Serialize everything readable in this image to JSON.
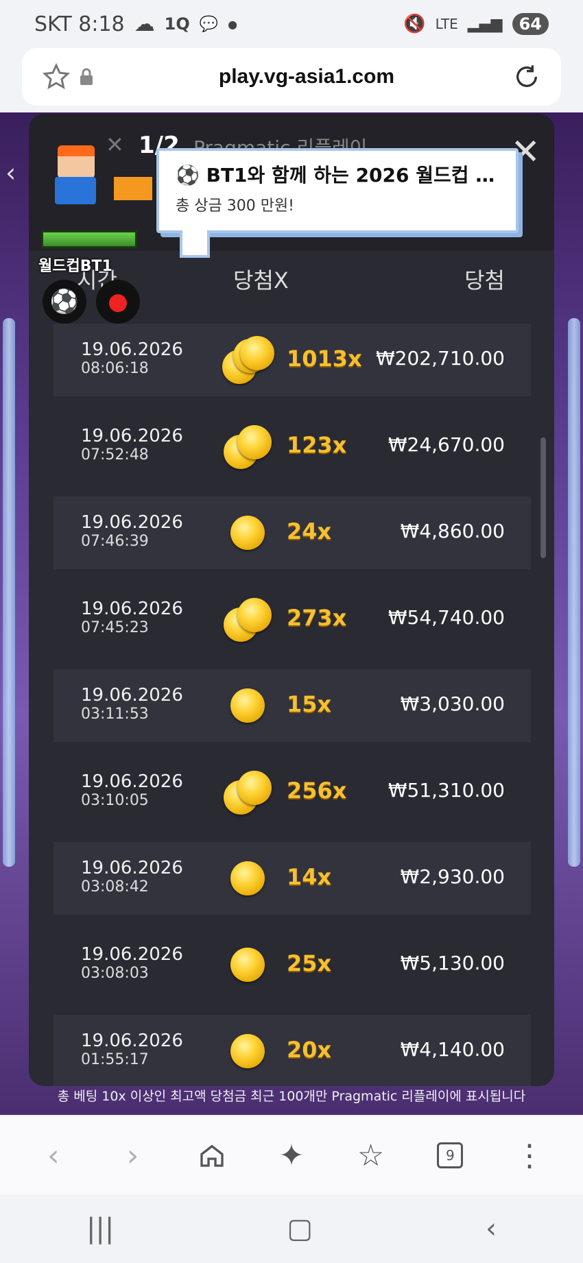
{
  "status": {
    "carrier_time": "SKT 8:18",
    "network": "LTE",
    "battery": "64",
    "icons": [
      "cloud-icon",
      "1q-icon",
      "talk-icon",
      "dot-icon",
      "mute-icon",
      "signal-icon"
    ]
  },
  "browser": {
    "url": "play.vg-asia1.com",
    "tabs_count": "9"
  },
  "panel": {
    "pager": "1/2",
    "title": "Pragmatic 리플레이",
    "headers": {
      "time": "시간",
      "multiplier": "당첨X",
      "win": "당첨"
    },
    "rows": [
      {
        "date": "19.06.2026",
        "time": "08:06:18",
        "mult": "1013x",
        "win": "₩202,710.00",
        "coins": 3
      },
      {
        "date": "19.06.2026",
        "time": "07:52:48",
        "mult": "123x",
        "win": "₩24,670.00",
        "coins": 2
      },
      {
        "date": "19.06.2026",
        "time": "07:46:39",
        "mult": "24x",
        "win": "₩4,860.00",
        "coins": 1
      },
      {
        "date": "19.06.2026",
        "time": "07:45:23",
        "mult": "273x",
        "win": "₩54,740.00",
        "coins": 2
      },
      {
        "date": "19.06.2026",
        "time": "03:11:53",
        "mult": "15x",
        "win": "₩3,030.00",
        "coins": 1
      },
      {
        "date": "19.06.2026",
        "time": "03:10:05",
        "mult": "256x",
        "win": "₩51,310.00",
        "coins": 2
      },
      {
        "date": "19.06.2026",
        "time": "03:08:42",
        "mult": "14x",
        "win": "₩2,930.00",
        "coins": 1
      },
      {
        "date": "19.06.2026",
        "time": "03:08:03",
        "mult": "25x",
        "win": "₩5,130.00",
        "coins": 1
      },
      {
        "date": "19.06.2026",
        "time": "01:55:17",
        "mult": "20x",
        "win": "₩4,140.00",
        "coins": 1
      }
    ],
    "footer": "총 베팅 10x 이상인 최고액 당첨금 최근 100개만 Pragmatic 리플레이에 표시됩니다"
  },
  "overlay": {
    "label": "월드컵BT1",
    "bubble_title": "⚽ BT1와 함께 하는 2026 월드컵 그...",
    "bubble_sub": "총 상금 300 만원!"
  },
  "colors": {
    "panel_bg": "#2a2a33",
    "multiplier": "#f7c030",
    "accent_orange": "#f59820"
  }
}
